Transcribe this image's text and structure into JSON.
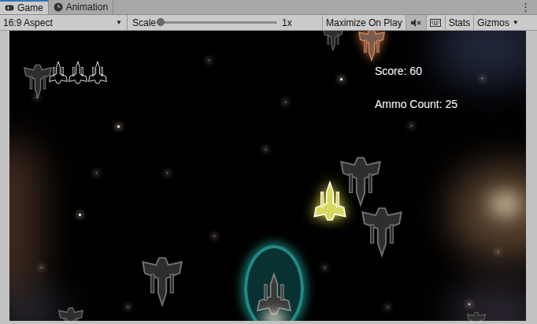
{
  "tabs": [
    {
      "label": "Game",
      "selected": true
    },
    {
      "label": "Animation",
      "selected": false
    }
  ],
  "menu_icon": "⋮",
  "toolbar": {
    "aspect": "16:9 Aspect",
    "aspect_arrow": "▼",
    "scale_label": "Scale",
    "scale_level": 0,
    "scale_value": "1x",
    "maximize_on_play": "Maximize On Play",
    "maximize_selected": false,
    "mute_selected": true,
    "stats": "Stats",
    "gizmos": "Gizmos",
    "gizmos_arrow": "▼"
  },
  "hud": {
    "score": "Score: 60",
    "ammo": "Ammo Count: 25",
    "lives": 3
  }
}
